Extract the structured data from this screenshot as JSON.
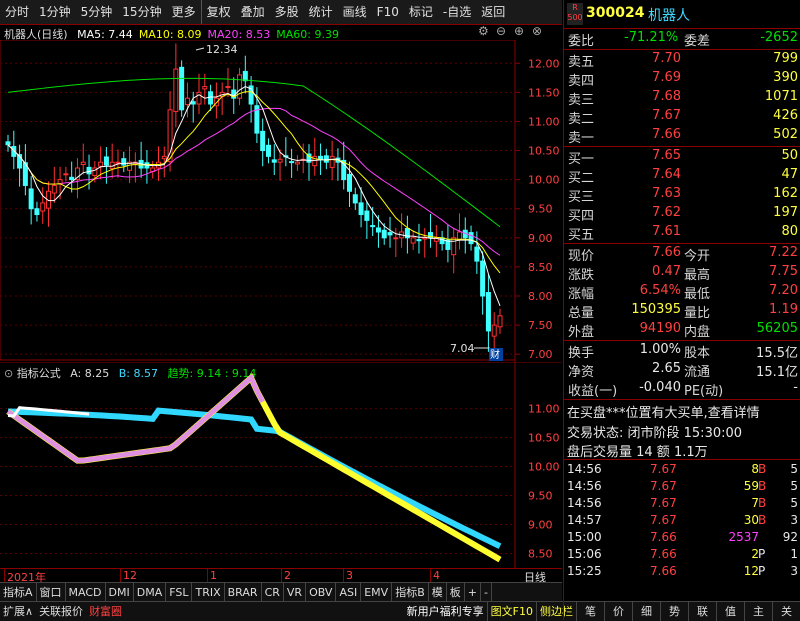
{
  "toolbar": {
    "items": [
      "分时",
      "1分钟",
      "5分钟",
      "15分钟",
      "更多",
      "复权",
      "叠加",
      "多股",
      "统计",
      "画线",
      "F10",
      "标记",
      "-自选",
      "返回"
    ]
  },
  "main_chart": {
    "title": "机器人(日线)",
    "ma": [
      {
        "label": "MA5: 7.44",
        "color": "#ffffff"
      },
      {
        "label": "MA10: 8.09",
        "color": "#ffff00"
      },
      {
        "label": "MA20: 8.53",
        "color": "#ff40ff"
      },
      {
        "label": "MA60: 9.39",
        "color": "#00e000"
      }
    ],
    "high_label": "12.34",
    "low_label": "7.04",
    "cai_label": "财",
    "price_ticks": [
      "12.00",
      "11.50",
      "11.00",
      "10.50",
      "10.00",
      "9.50",
      "9.00",
      "8.50",
      "8.00",
      "7.50",
      "7.00"
    ]
  },
  "indicator": {
    "title": "指标公式",
    "a": "A: 8.25",
    "b": "B: 8.57",
    "trend": "趋势: 9.14 : 9.14",
    "ticks": [
      "11.00",
      "10.50",
      "10.00",
      "9.50",
      "9.00",
      "8.50"
    ]
  },
  "date_axis": {
    "labels": [
      "2021年",
      "12",
      "1",
      "2",
      "3",
      "4"
    ],
    "period": "日线"
  },
  "bottom_tabs": [
    "指标A",
    "窗口",
    "MACD",
    "DMI",
    "DMA",
    "FSL",
    "TRIX",
    "BRAR",
    "CR",
    "VR",
    "OBV",
    "ASI",
    "EMV",
    "",
    "指标B",
    "模",
    "板",
    "+",
    "-"
  ],
  "bottom_bar2": {
    "left": [
      "扩展∧",
      "关联报价",
      "财富圈"
    ],
    "news": "新用户福利专享",
    "mid": [
      "图文F10",
      "侧边栏"
    ],
    "right": [
      "笔",
      "价",
      "细",
      "势",
      "联",
      "值",
      "主",
      "关"
    ]
  },
  "quote": {
    "badge": "R 500",
    "code": "300024",
    "name": "机器人",
    "weibi_label": "委比",
    "weibi": "-71.21%",
    "weicha_label": "委差",
    "weicha": "-2652",
    "asks": [
      {
        "label": "卖五",
        "price": "7.70",
        "vol": "799"
      },
      {
        "label": "卖四",
        "price": "7.69",
        "vol": "390"
      },
      {
        "label": "卖三",
        "price": "7.68",
        "vol": "1071"
      },
      {
        "label": "卖二",
        "price": "7.67",
        "vol": "426"
      },
      {
        "label": "卖一",
        "price": "7.66",
        "vol": "502"
      }
    ],
    "bids": [
      {
        "label": "买一",
        "price": "7.65",
        "vol": "50"
      },
      {
        "label": "买二",
        "price": "7.64",
        "vol": "47"
      },
      {
        "label": "买三",
        "price": "7.63",
        "vol": "162"
      },
      {
        "label": "买四",
        "price": "7.62",
        "vol": "197"
      },
      {
        "label": "买五",
        "price": "7.61",
        "vol": "80"
      }
    ],
    "stats": [
      {
        "l1": "现价",
        "v1": "7.66",
        "c1": "red",
        "l2": "今开",
        "v2": "7.22",
        "c2": "red"
      },
      {
        "l1": "涨跌",
        "v1": "0.47",
        "c1": "red",
        "l2": "最高",
        "v2": "7.75",
        "c2": "red"
      },
      {
        "l1": "涨幅",
        "v1": "6.54%",
        "c1": "red",
        "l2": "最低",
        "v2": "7.20",
        "c2": "red"
      },
      {
        "l1": "总量",
        "v1": "150395",
        "c1": "yel",
        "l2": "量比",
        "v2": "1.19",
        "c2": "red"
      },
      {
        "l1": "外盘",
        "v1": "94190",
        "c1": "red",
        "l2": "内盘",
        "v2": "56205",
        "c2": "green"
      }
    ],
    "stats2": [
      {
        "l1": "换手",
        "v1": "1.00%",
        "l2": "股本",
        "v2": "15.5亿"
      },
      {
        "l1": "净资",
        "v1": "2.65",
        "l2": "流通",
        "v2": "15.1亿"
      },
      {
        "l1": "收益(一)",
        "v1": "-0.040",
        "l2": "PE(动)",
        "v2": "-"
      }
    ],
    "news1": "在买盘***位置有大买单,查看详情",
    "status": "交易状态: 闭市阶段 15:30:00",
    "after": "盘后交易量 14 额 1.1万",
    "ticks": [
      {
        "t": "14:56",
        "p": "7.67",
        "v": "8",
        "bs": "B",
        "n": "5",
        "vc": "yel"
      },
      {
        "t": "14:56",
        "p": "7.67",
        "v": "59",
        "bs": "B",
        "n": "5",
        "vc": "yel"
      },
      {
        "t": "14:56",
        "p": "7.67",
        "v": "7",
        "bs": "B",
        "n": "5",
        "vc": "yel"
      },
      {
        "t": "14:57",
        "p": "7.67",
        "v": "30",
        "bs": "B",
        "n": "3",
        "vc": "yel"
      },
      {
        "t": "15:00",
        "p": "7.66",
        "v": "2537",
        "bs": "",
        "n": "92",
        "vc": "mag"
      },
      {
        "t": "15:06",
        "p": "7.66",
        "v": "2",
        "bs": "P",
        "n": "1",
        "vc": "yel"
      },
      {
        "t": "15:25",
        "p": "7.66",
        "v": "12",
        "bs": "P",
        "n": "3",
        "vc": "yel"
      }
    ]
  }
}
